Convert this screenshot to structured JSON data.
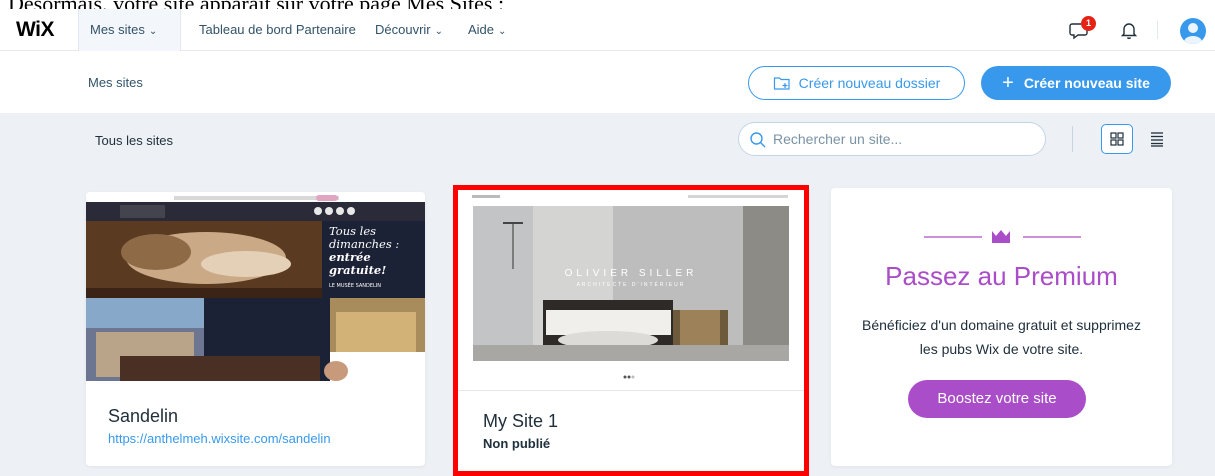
{
  "caption": "Désormais, votre site apparaît sur votre page Mes Sites :",
  "topbar": {
    "logo": "WiX",
    "nav": [
      {
        "label": "Mes sites",
        "has_dropdown": true
      },
      {
        "label": "Tableau de bord Partenaire",
        "has_dropdown": false
      },
      {
        "label": "Découvrir",
        "has_dropdown": true
      },
      {
        "label": "Aide",
        "has_dropdown": true
      }
    ],
    "notifications_badge": "1",
    "icons": [
      "chat-icon",
      "bell-icon",
      "avatar"
    ]
  },
  "header": {
    "title": "Mes sites",
    "new_folder_label": "Créer nouveau dossier",
    "new_site_label": "Créer nouveau site"
  },
  "toolbar": {
    "filter_label": "Tous les sites",
    "search_placeholder": "Rechercher un site...",
    "view_modes": [
      "grid",
      "list"
    ],
    "active_view": "grid"
  },
  "sites": [
    {
      "name": "Sandelin",
      "url": "https://anthelmeh.wixsite.com/sandelin",
      "thumb": {
        "headline_lines": [
          "Tous les",
          "dimanches :",
          "entrée",
          "gratuite!"
        ],
        "sub": "LE MUSÉE SANDELIN"
      }
    },
    {
      "name": "My Site 1",
      "status": "Non publié",
      "highlighted": true,
      "thumb": {
        "brand": "OLIVIER SILLER",
        "tagline": "ARCHITECTE D'INTÉRIEUR"
      }
    }
  ],
  "premium": {
    "title": "Passez au Premium",
    "description": "Bénéficiez d'un domaine gratuit et supprimez les pubs Wix de votre site.",
    "button_label": "Boostez votre site"
  },
  "colors": {
    "accent": "#3899ec",
    "premium": "#aa4dc8",
    "highlight": "#ff0000",
    "background": "#edf1f5"
  }
}
